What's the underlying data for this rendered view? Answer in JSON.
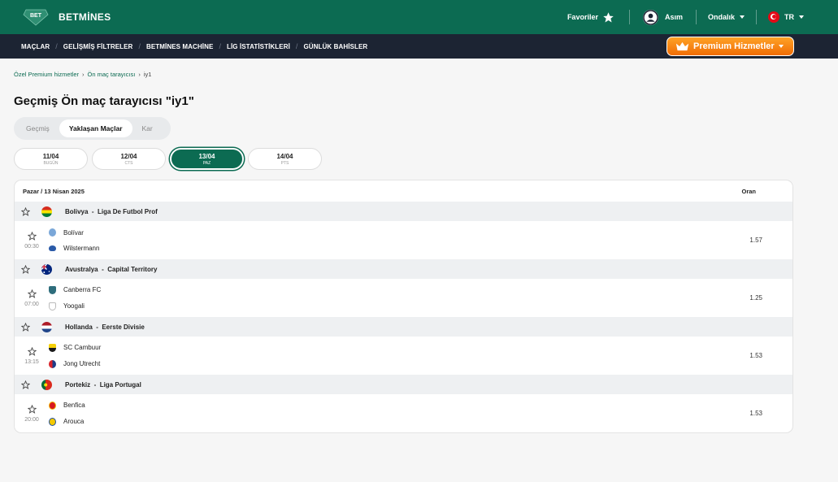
{
  "header": {
    "brand": "BETMİNES",
    "logo_text": "BET",
    "favorites": "Favoriler",
    "user": "Asım",
    "odds_format": "Ondalık",
    "language": "TR"
  },
  "nav": {
    "items": [
      "MAÇLAR",
      "GELİŞMİŞ FİLTRELER",
      "BETMİNES MACHİNE",
      "LİG İSTATİSTİKLERİ",
      "GÜNLÜK BAHİSLER"
    ],
    "premium": "Premium Hizmetler"
  },
  "breadcrumb": [
    "Özel Premium hizmetler",
    "Ön maç tarayıcısı",
    "iy1"
  ],
  "page_title": "Geçmiş Ön maç tarayıcısı \"iy1\"",
  "tabs": [
    "Geçmiş",
    "Yaklaşan Maçlar",
    "Kar"
  ],
  "active_tab": "Yaklaşan Maçlar",
  "dates": [
    {
      "date": "11/04",
      "day": "BUGÜN"
    },
    {
      "date": "12/04",
      "day": "CTS"
    },
    {
      "date": "13/04",
      "day": "PAZ",
      "active": true
    },
    {
      "date": "14/04",
      "day": "PTS"
    }
  ],
  "card": {
    "date_heading": "Pazar / 13 Nisan 2025",
    "odds_heading": "Oran"
  },
  "leagues": [
    {
      "country": "Bolivya",
      "league": "Liga De Futbol Prof",
      "flag": "bolivia",
      "match": {
        "time": "00:30",
        "home": "Bolívar",
        "away": "Wilstermann",
        "odds": "1.57"
      }
    },
    {
      "country": "Avustralya",
      "league": "Capital Territory",
      "flag": "australia",
      "match": {
        "time": "07:00",
        "home": "Canberra FC",
        "away": "Yoogali",
        "odds": "1.25"
      }
    },
    {
      "country": "Hollanda",
      "league": "Eerste Divisie",
      "flag": "netherlands",
      "match": {
        "time": "13:15",
        "home": "SC Cambuur",
        "away": "Jong Utrecht",
        "odds": "1.53"
      }
    },
    {
      "country": "Portekiz",
      "league": "Liga Portugal",
      "flag": "portugal",
      "match": {
        "time": "20:00",
        "home": "Benfica",
        "away": "Arouca",
        "odds": "1.53"
      }
    }
  ],
  "colors": {
    "brand": "#0c6b52",
    "nav": "#1c2433",
    "premium": "#f58a14"
  }
}
